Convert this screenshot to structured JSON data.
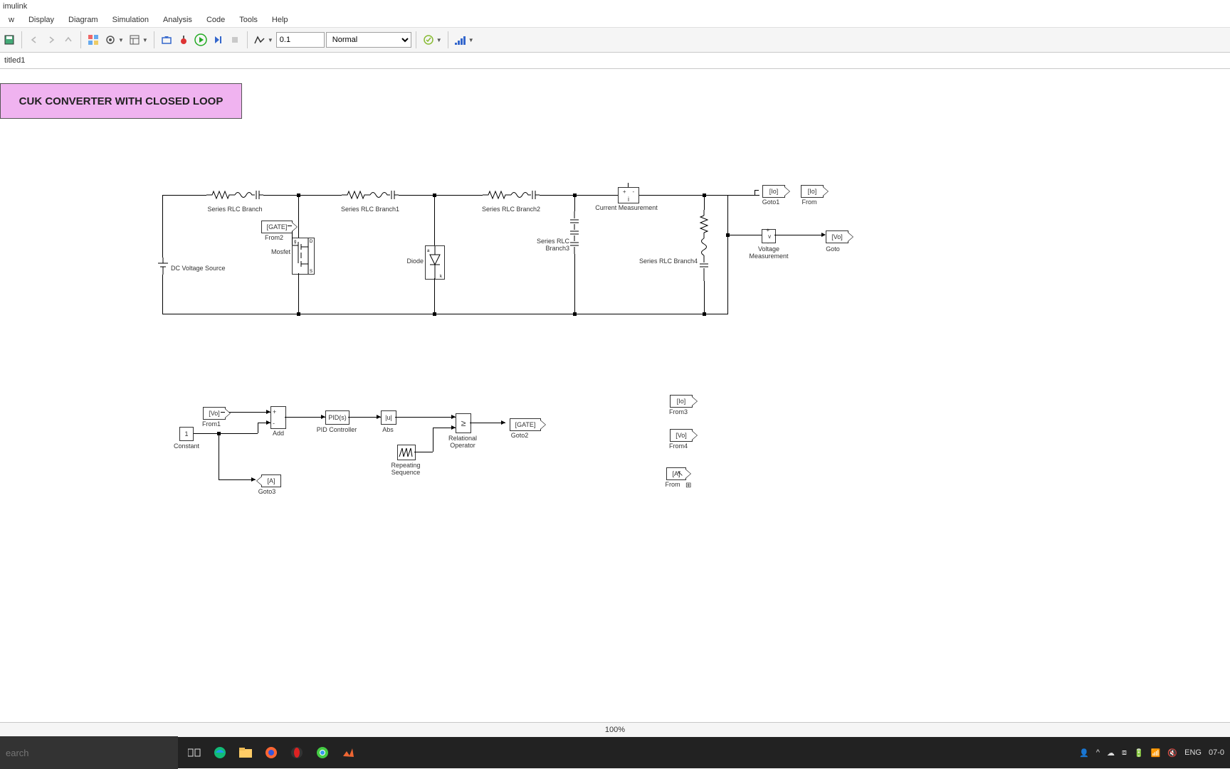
{
  "app": {
    "title": "imulink"
  },
  "menu": [
    "w",
    "Display",
    "Diagram",
    "Simulation",
    "Analysis",
    "Code",
    "Tools",
    "Help"
  ],
  "toolbar": {
    "stop_time": "0.1",
    "mode": "Normal"
  },
  "breadcrumb": "titled1",
  "diagram": {
    "title": "CUK CONVERTER WITH CLOSED LOOP",
    "blocks": {
      "dc_source": "DC Voltage Source",
      "rlc": "Series RLC Branch",
      "rlc1": "Series RLC Branch1",
      "rlc2": "Series RLC Branch2",
      "rlc3": "Series RLC Branch3",
      "rlc4": "Series RLC Branch4",
      "mosfet": "Mosfet",
      "diode": "Diode",
      "current_meas": "Current Measurement",
      "voltage_meas": "Voltage Measurement",
      "goto": "Goto",
      "goto1": "Goto1",
      "goto2": "Goto2",
      "goto3": "Goto3",
      "from": "From",
      "from1": "From1",
      "from2": "From2",
      "from3": "From3",
      "from4": "From4",
      "from5": "From",
      "add": "Add",
      "constant": "Constant",
      "pid": "PID Controller",
      "pid_text": "PID(s)",
      "abs": "Abs",
      "abs_text": "|u|",
      "rel_op": "Relational\nOperator",
      "rel_sym": "≥",
      "rep_seq": "Repeating\nSequence",
      "const_val": "1"
    },
    "tags": {
      "gate": "[GATE]",
      "io": "[Io]",
      "vo": "[Vo]",
      "a": "[A]",
      "v_sym": "v",
      "i_sym": "i"
    }
  },
  "status": {
    "zoom": "100%"
  },
  "taskbar": {
    "search_ph": "earch",
    "lang": "ENG",
    "date": "07-0"
  }
}
